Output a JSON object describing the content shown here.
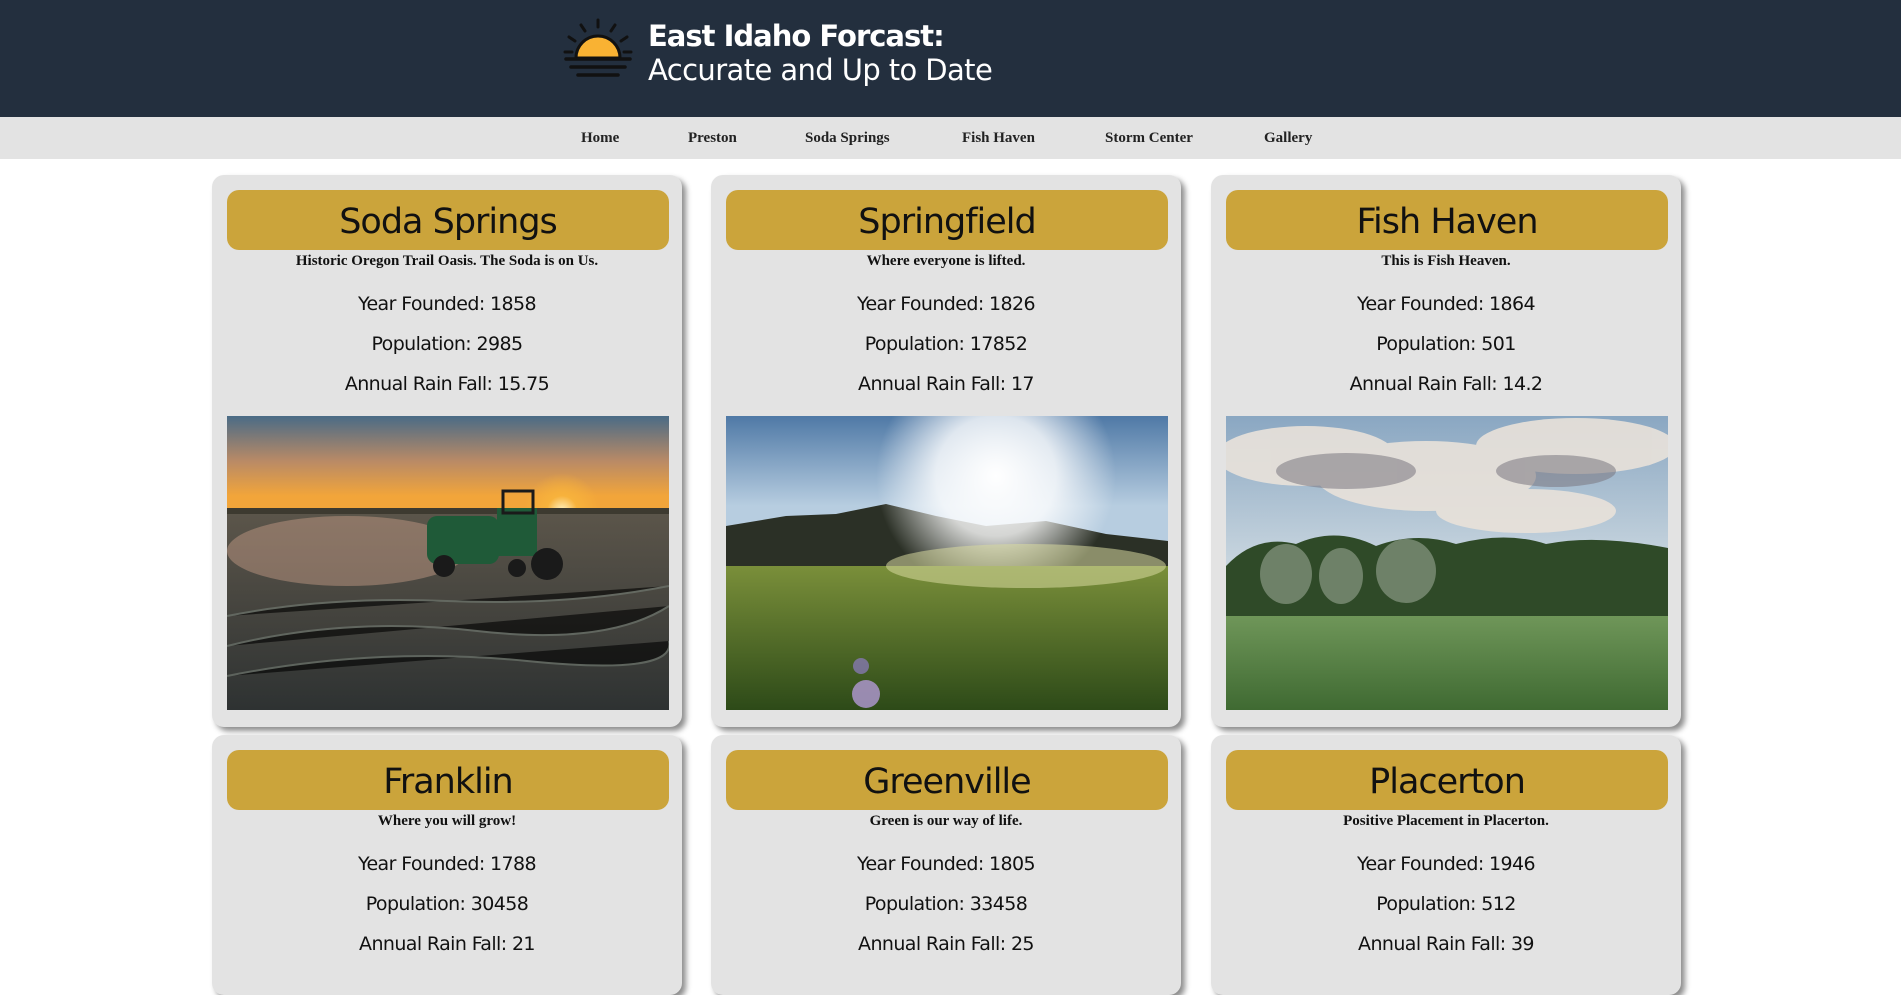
{
  "header": {
    "title_line1": "East Idaho Forcast:",
    "title_line2": "Accurate and Up to Date"
  },
  "nav": {
    "items": [
      {
        "label": "Home"
      },
      {
        "label": "Preston"
      },
      {
        "label": "Soda Springs"
      },
      {
        "label": "Fish Haven"
      },
      {
        "label": "Storm Center"
      },
      {
        "label": "Gallery"
      }
    ]
  },
  "towns": [
    {
      "name": "Soda Springs",
      "motto": "Historic Oregon Trail Oasis. The Soda is on Us.",
      "founded": "Year Founded: 1858",
      "population": "Population: 2985",
      "rain": "Annual Rain Fall: 15.75",
      "image": "tractor-sunset-photo"
    },
    {
      "name": "Springfield",
      "motto": "Where everyone is lifted.",
      "founded": "Year Founded: 1826",
      "population": "Population: 17852",
      "rain": "Annual Rain Fall: 17",
      "image": "sunlit-meadow-photo"
    },
    {
      "name": "Fish Haven",
      "motto": "This is Fish Heaven.",
      "founded": "Year Founded: 1864",
      "population": "Population: 501",
      "rain": "Annual Rain Fall: 14.2",
      "image": "cloudy-field-photo"
    },
    {
      "name": "Franklin",
      "motto": "Where you will grow!",
      "founded": "Year Founded: 1788",
      "population": "Population: 30458",
      "rain": "Annual Rain Fall: 21"
    },
    {
      "name": "Greenville",
      "motto": "Green is our way of life.",
      "founded": "Year Founded: 1805",
      "population": "Population: 33458",
      "rain": "Annual Rain Fall: 25"
    },
    {
      "name": "Placerton",
      "motto": "Positive Placement in Placerton.",
      "founded": "Year Founded: 1946",
      "population": "Population: 512",
      "rain": "Annual Rain Fall: 39"
    }
  ],
  "colors": {
    "header_bg": "#232f3e",
    "nav_bg": "#e3e3e3",
    "card_bg": "#e3e3e3",
    "title_bar": "#cba43b",
    "sun": "#f9b233"
  }
}
